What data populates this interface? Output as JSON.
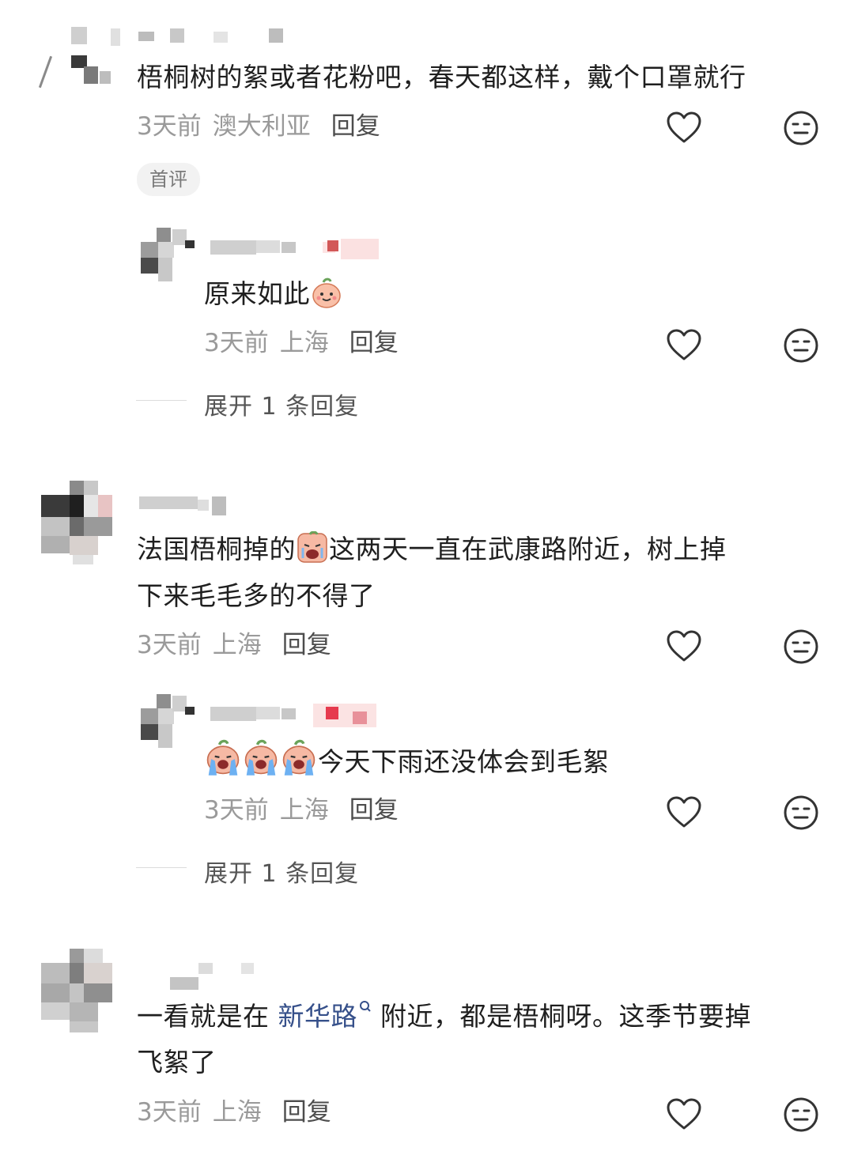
{
  "comments": [
    {
      "text": "梧桐树的絮或者花粉吧，春天都这样，戴个口罩就行",
      "time": "3天前",
      "location": "澳大利亚",
      "reply_label": "回复",
      "badge": "首评",
      "replies": [
        {
          "text": "原来如此",
          "emoji": "smiling-peach-emoji",
          "time": "3天前",
          "location": "上海",
          "reply_label": "回复"
        }
      ],
      "expand_label": "展开 1 条回复"
    },
    {
      "text_before": "法国梧桐掉的",
      "emoji": "crying-peach-emoji",
      "text_after": "这两天一直在武康路附近，树上掉",
      "text_line2": "下来毛毛多的不得了",
      "time": "3天前",
      "location": "上海",
      "reply_label": "回复",
      "replies": [
        {
          "emojis": [
            "sobbing-peach-emoji",
            "sobbing-peach-emoji",
            "sobbing-peach-emoji"
          ],
          "text": "今天下雨还没体会到毛絮",
          "time": "3天前",
          "location": "上海",
          "reply_label": "回复"
        }
      ],
      "expand_label": "展开 1 条回复"
    },
    {
      "text_before": "一看就是在 ",
      "link_text": "新华路",
      "text_after": " 附近，都是梧桐呀。这季节要掉",
      "text_line2": "飞絮了",
      "time": "3天前",
      "location": "上海",
      "reply_label": "回复"
    }
  ],
  "colors": {
    "link": "#36508a",
    "meta": "#9a9a9a",
    "badge_bg": "#f2f2f2"
  },
  "icons": [
    "heart-outline-icon",
    "neutral-face-icon",
    "search-small-icon"
  ]
}
